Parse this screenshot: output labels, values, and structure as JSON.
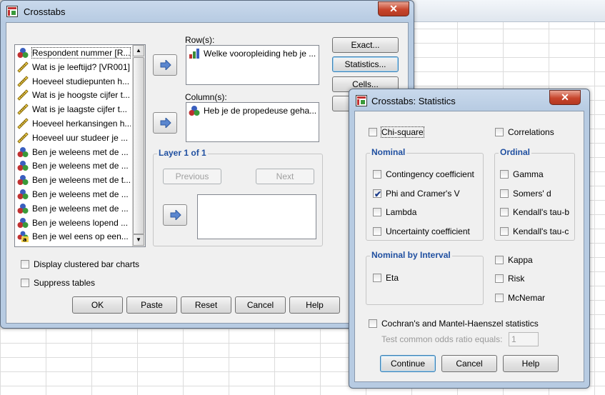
{
  "background": {
    "app": "spreadsheet"
  },
  "crosstabs": {
    "title": "Crosstabs",
    "close_glyph": "✕",
    "variables": [
      {
        "label": "Respondent nummer [R...",
        "icon": "nominal-icon"
      },
      {
        "label": "Wat is je leeftijd? [VR001]",
        "icon": "scale-ruler-icon"
      },
      {
        "label": "Hoeveel studiepunten h...",
        "icon": "scale-ruler-icon"
      },
      {
        "label": "Wat is je hoogste cijfer t...",
        "icon": "scale-ruler-icon"
      },
      {
        "label": "Wat is je laagste cijfer t...",
        "icon": "scale-ruler-icon"
      },
      {
        "label": "Hoeveel herkansingen h...",
        "icon": "scale-ruler-icon"
      },
      {
        "label": "Hoeveel uur studeer je ...",
        "icon": "scale-ruler-icon"
      },
      {
        "label": "Ben je weleens met de ...",
        "icon": "nominal-icon"
      },
      {
        "label": "Ben je weleens met de ...",
        "icon": "nominal-icon"
      },
      {
        "label": "Ben je weleens met de t...",
        "icon": "nominal-icon"
      },
      {
        "label": "Ben je weleens met de ...",
        "icon": "nominal-icon"
      },
      {
        "label": "Ben je weleens met de ...",
        "icon": "nominal-icon"
      },
      {
        "label": "Ben je weleens lopend ...",
        "icon": "nominal-icon"
      },
      {
        "label": "Ben je wel eens op een...",
        "icon": "string-nominal-icon"
      }
    ],
    "rows_label": "Row(s):",
    "rows_value": "Welke vooropleiding heb je ...",
    "columns_label": "Column(s):",
    "columns_value": "Heb je de propedeuse geha...",
    "layer_title": "Layer 1 of 1",
    "previous_label": "Previous",
    "next_label": "Next",
    "side_buttons": {
      "exact": "Exact...",
      "statistics": "Statistics...",
      "cells": "Cells..."
    },
    "display_clustered": "Display clustered bar charts",
    "suppress_tables": "Suppress tables",
    "bottom_buttons": {
      "ok": "OK",
      "paste": "Paste",
      "reset": "Reset",
      "cancel": "Cancel",
      "help": "Help"
    }
  },
  "statistics": {
    "title": "Crosstabs: Statistics",
    "close_glyph": "✕",
    "chi_square": {
      "label": "Chi-square",
      "checked": false
    },
    "correlations": {
      "label": "Correlations",
      "checked": false
    },
    "nominal_title": "Nominal",
    "nominal": [
      {
        "label": "Contingency coefficient",
        "checked": false
      },
      {
        "label": "Phi and Cramer's V",
        "checked": true
      },
      {
        "label": "Lambda",
        "checked": false
      },
      {
        "label": "Uncertainty coefficient",
        "checked": false
      }
    ],
    "ordinal_title": "Ordinal",
    "ordinal": [
      {
        "label": "Gamma",
        "checked": false
      },
      {
        "label": "Somers' d",
        "checked": false
      },
      {
        "label": "Kendall's tau-b",
        "checked": false
      },
      {
        "label": "Kendall's tau-c",
        "checked": false
      }
    ],
    "nominal_interval_title": "Nominal by Interval",
    "eta": {
      "label": "Eta",
      "checked": false
    },
    "kappa": {
      "label": "Kappa",
      "checked": false
    },
    "risk": {
      "label": "Risk",
      "checked": false
    },
    "mcnemar": {
      "label": "McNemar",
      "checked": false
    },
    "cochran": {
      "label": "Cochran's and Mantel-Haenszel statistics",
      "checked": false
    },
    "odds_label": "Test common odds ratio equals:",
    "odds_value": "1",
    "buttons": {
      "continue": "Continue",
      "cancel": "Cancel",
      "help": "Help"
    },
    "check_glyph": "✔"
  }
}
